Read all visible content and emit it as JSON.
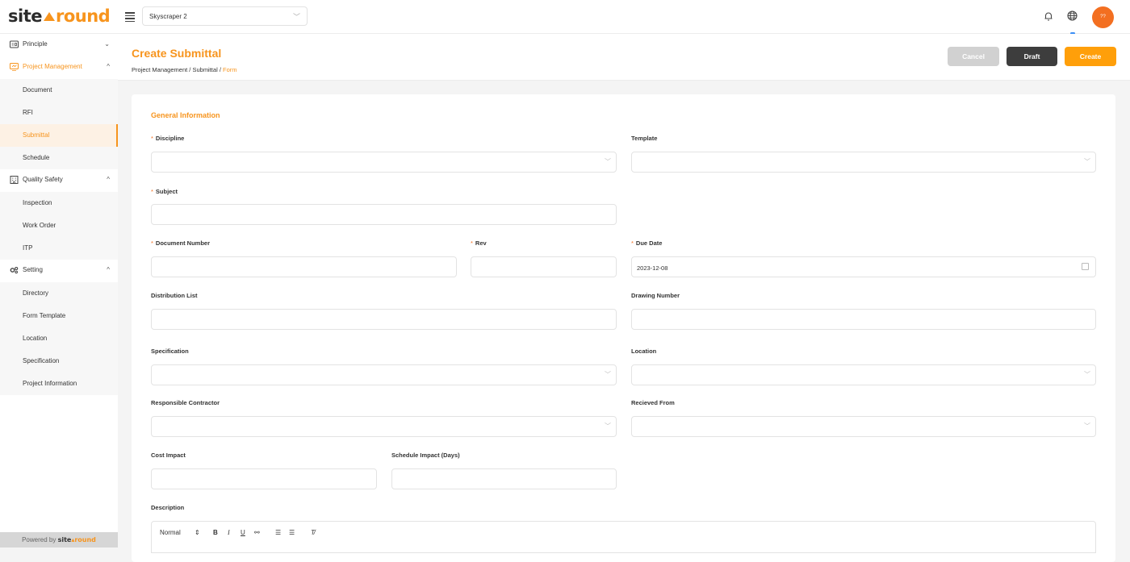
{
  "brand": {
    "logo_left": "site",
    "logo_right": "round",
    "powered_by": "Powered by",
    "powered_left": "site",
    "powered_right": "round"
  },
  "header": {
    "project": "Skyscraper 2",
    "avatar_initials": "??"
  },
  "sidebar": {
    "principle": "Principle",
    "project_management": "Project Management",
    "pm_items": [
      "Document",
      "RFI",
      "Submittal",
      "Schedule"
    ],
    "quality_safety": "Quality Safety",
    "qs_items": [
      "Inspection",
      "Work Order",
      "ITP"
    ],
    "setting": "Setting",
    "setting_items": [
      "Directory",
      "Form Template",
      "Location",
      "Specification",
      "Project Information"
    ]
  },
  "page": {
    "title": "Create Submittal",
    "breadcrumb": {
      "a": "Project Management",
      "b": "Submittal",
      "c": "Form",
      "sep": " / "
    },
    "buttons": {
      "cancel": "Cancel",
      "draft": "Draft",
      "create": "Create"
    }
  },
  "form": {
    "section": "General Information",
    "required_mark": "*",
    "discipline": "Discipline",
    "template": "Template",
    "subject": "Subject",
    "document_number": "Document Number",
    "rev": "Rev",
    "due_date": "Due Date",
    "due_date_value": "2023-12-08",
    "distribution_list": "Distribution List",
    "drawing_number": "Drawing Number",
    "specification": "Specification",
    "location": "Location",
    "responsible_contractor": "Responsible Contractor",
    "received_from": "Recieved From",
    "cost_impact": "Cost Impact",
    "schedule_impact": "Schedule Impact  (Days)",
    "description": "Description",
    "editor_format": "Normal"
  },
  "colors": {
    "accent": "#f7941d",
    "create_button": "#ff9f0a",
    "draft_button": "#3d3d3d",
    "cancel_button": "#d1d1d1",
    "avatar": "#f36f21"
  }
}
